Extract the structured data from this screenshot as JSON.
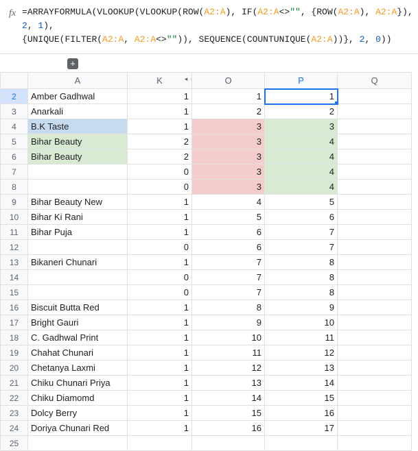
{
  "formula": {
    "parts": [
      {
        "t": "=",
        "c": "tok-func"
      },
      {
        "t": "ARRAYFORMULA",
        "c": "tok-func"
      },
      {
        "t": "(",
        "c": ""
      },
      {
        "t": "VLOOKUP",
        "c": "tok-func"
      },
      {
        "t": "(",
        "c": ""
      },
      {
        "t": "VLOOKUP",
        "c": "tok-func"
      },
      {
        "t": "(",
        "c": ""
      },
      {
        "t": "ROW",
        "c": "tok-func"
      },
      {
        "t": "(",
        "c": ""
      },
      {
        "t": "A2:A",
        "c": "tok-ref"
      },
      {
        "t": ")",
        "c": ""
      },
      {
        "t": ", ",
        "c": ""
      },
      {
        "t": "IF",
        "c": "tok-func"
      },
      {
        "t": "(",
        "c": ""
      },
      {
        "t": "A2:A",
        "c": "tok-ref"
      },
      {
        "t": "<>",
        "c": ""
      },
      {
        "t": "\"\"",
        "c": "tok-str"
      },
      {
        "t": ", {",
        "c": ""
      },
      {
        "t": "ROW",
        "c": "tok-func"
      },
      {
        "t": "(",
        "c": ""
      },
      {
        "t": "A2:A",
        "c": "tok-ref"
      },
      {
        "t": ")",
        "c": ""
      },
      {
        "t": ", ",
        "c": ""
      },
      {
        "t": "A2:A",
        "c": "tok-ref"
      },
      {
        "t": "})",
        "c": ""
      },
      {
        "t": ", ",
        "c": ""
      },
      {
        "t": "2",
        "c": "tok-num"
      },
      {
        "t": ", ",
        "c": ""
      },
      {
        "t": "1",
        "c": "tok-num"
      },
      {
        "t": "),",
        "c": ""
      },
      {
        "t": "\n",
        "c": ""
      },
      {
        "t": "{",
        "c": ""
      },
      {
        "t": "UNIQUE",
        "c": "tok-func"
      },
      {
        "t": "(",
        "c": ""
      },
      {
        "t": "FILTER",
        "c": "tok-func"
      },
      {
        "t": "(",
        "c": ""
      },
      {
        "t": "A2:A",
        "c": "tok-ref"
      },
      {
        "t": ", ",
        "c": ""
      },
      {
        "t": "A2:A",
        "c": "tok-ref"
      },
      {
        "t": "<>",
        "c": ""
      },
      {
        "t": "\"\"",
        "c": "tok-str"
      },
      {
        "t": "))",
        "c": ""
      },
      {
        "t": ", ",
        "c": ""
      },
      {
        "t": "SEQUENCE",
        "c": "tok-func"
      },
      {
        "t": "(",
        "c": ""
      },
      {
        "t": "COUNTUNIQUE",
        "c": "tok-func"
      },
      {
        "t": "(",
        "c": ""
      },
      {
        "t": "A2:A",
        "c": "tok-ref"
      },
      {
        "t": "))}",
        "c": ""
      },
      {
        "t": ", ",
        "c": ""
      },
      {
        "t": "2",
        "c": "tok-num"
      },
      {
        "t": ", ",
        "c": ""
      },
      {
        "t": "0",
        "c": "tok-num"
      },
      {
        "t": "))",
        "c": ""
      }
    ]
  },
  "fx_label": "fx",
  "add_col_glyph": "+",
  "columns": [
    {
      "id": "rowhdr",
      "label": "",
      "class": "col-rowhdr"
    },
    {
      "id": "A",
      "label": "A",
      "class": "col-A"
    },
    {
      "id": "K",
      "label": "K",
      "class": "col-K",
      "collapsed_right": true
    },
    {
      "id": "O",
      "label": "O",
      "class": "col-O"
    },
    {
      "id": "P",
      "label": "P",
      "class": "col-P",
      "selected": true
    },
    {
      "id": "Q",
      "label": "Q",
      "class": "col-Q"
    }
  ],
  "active_cell": {
    "row": 2,
    "col": "P"
  },
  "rows": [
    {
      "n": 2,
      "sel": true,
      "A": {
        "v": "Amber Gadhwal"
      },
      "K": {
        "v": "1"
      },
      "O": {
        "v": "1"
      },
      "P": {
        "v": "1",
        "active": true
      },
      "Q": {
        "v": ""
      }
    },
    {
      "n": 3,
      "A": {
        "v": "Anarkali"
      },
      "K": {
        "v": "1"
      },
      "O": {
        "v": "2"
      },
      "P": {
        "v": "2"
      },
      "Q": {
        "v": ""
      }
    },
    {
      "n": 4,
      "A": {
        "v": "B.K Taste",
        "hl": "blue"
      },
      "K": {
        "v": "1"
      },
      "O": {
        "v": "3",
        "hl": "red"
      },
      "P": {
        "v": "3",
        "hl": "green"
      },
      "Q": {
        "v": ""
      }
    },
    {
      "n": 5,
      "A": {
        "v": "Bihar Beauty",
        "hl": "green"
      },
      "K": {
        "v": "2"
      },
      "O": {
        "v": "3",
        "hl": "red"
      },
      "P": {
        "v": "4",
        "hl": "green"
      },
      "Q": {
        "v": ""
      }
    },
    {
      "n": 6,
      "A": {
        "v": "Bihar Beauty",
        "hl": "green"
      },
      "K": {
        "v": "2"
      },
      "O": {
        "v": "3",
        "hl": "red"
      },
      "P": {
        "v": "4",
        "hl": "green"
      },
      "Q": {
        "v": ""
      }
    },
    {
      "n": 7,
      "A": {
        "v": ""
      },
      "K": {
        "v": "0"
      },
      "O": {
        "v": "3",
        "hl": "red"
      },
      "P": {
        "v": "4",
        "hl": "green"
      },
      "Q": {
        "v": ""
      }
    },
    {
      "n": 8,
      "A": {
        "v": ""
      },
      "K": {
        "v": "0"
      },
      "O": {
        "v": "3",
        "hl": "red"
      },
      "P": {
        "v": "4",
        "hl": "green"
      },
      "Q": {
        "v": ""
      }
    },
    {
      "n": 9,
      "A": {
        "v": "Bihar Beauty New"
      },
      "K": {
        "v": "1"
      },
      "O": {
        "v": "4"
      },
      "P": {
        "v": "5"
      },
      "Q": {
        "v": ""
      }
    },
    {
      "n": 10,
      "A": {
        "v": "Bihar Ki Rani"
      },
      "K": {
        "v": "1"
      },
      "O": {
        "v": "5"
      },
      "P": {
        "v": "6"
      },
      "Q": {
        "v": ""
      }
    },
    {
      "n": 11,
      "A": {
        "v": "Bihar Puja"
      },
      "K": {
        "v": "1"
      },
      "O": {
        "v": "6"
      },
      "P": {
        "v": "7"
      },
      "Q": {
        "v": ""
      }
    },
    {
      "n": 12,
      "A": {
        "v": ""
      },
      "K": {
        "v": "0"
      },
      "O": {
        "v": "6"
      },
      "P": {
        "v": "7"
      },
      "Q": {
        "v": ""
      }
    },
    {
      "n": 13,
      "A": {
        "v": "Bikaneri Chunari"
      },
      "K": {
        "v": "1"
      },
      "O": {
        "v": "7"
      },
      "P": {
        "v": "8"
      },
      "Q": {
        "v": ""
      }
    },
    {
      "n": 14,
      "A": {
        "v": ""
      },
      "K": {
        "v": "0"
      },
      "O": {
        "v": "7"
      },
      "P": {
        "v": "8"
      },
      "Q": {
        "v": ""
      }
    },
    {
      "n": 15,
      "A": {
        "v": ""
      },
      "K": {
        "v": "0"
      },
      "O": {
        "v": "7"
      },
      "P": {
        "v": "8"
      },
      "Q": {
        "v": ""
      }
    },
    {
      "n": 16,
      "A": {
        "v": "Biscuit Butta Red"
      },
      "K": {
        "v": "1"
      },
      "O": {
        "v": "8"
      },
      "P": {
        "v": "9"
      },
      "Q": {
        "v": ""
      }
    },
    {
      "n": 17,
      "A": {
        "v": "Bright Gauri"
      },
      "K": {
        "v": "1"
      },
      "O": {
        "v": "9"
      },
      "P": {
        "v": "10"
      },
      "Q": {
        "v": ""
      }
    },
    {
      "n": 18,
      "A": {
        "v": "C. Gadhwal Print"
      },
      "K": {
        "v": "1"
      },
      "O": {
        "v": "10"
      },
      "P": {
        "v": "11"
      },
      "Q": {
        "v": ""
      }
    },
    {
      "n": 19,
      "A": {
        "v": "Chahat Chunari"
      },
      "K": {
        "v": "1"
      },
      "O": {
        "v": "11"
      },
      "P": {
        "v": "12"
      },
      "Q": {
        "v": ""
      }
    },
    {
      "n": 20,
      "A": {
        "v": "Chetanya Laxmi"
      },
      "K": {
        "v": "1"
      },
      "O": {
        "v": "12"
      },
      "P": {
        "v": "13"
      },
      "Q": {
        "v": ""
      }
    },
    {
      "n": 21,
      "A": {
        "v": "Chiku Chunari Priya"
      },
      "K": {
        "v": "1"
      },
      "O": {
        "v": "13"
      },
      "P": {
        "v": "14"
      },
      "Q": {
        "v": ""
      }
    },
    {
      "n": 22,
      "A": {
        "v": "Chiku Diamomd"
      },
      "K": {
        "v": "1"
      },
      "O": {
        "v": "14"
      },
      "P": {
        "v": "15"
      },
      "Q": {
        "v": ""
      }
    },
    {
      "n": 23,
      "A": {
        "v": "Dolcy Berry"
      },
      "K": {
        "v": "1"
      },
      "O": {
        "v": "15"
      },
      "P": {
        "v": "16"
      },
      "Q": {
        "v": ""
      }
    },
    {
      "n": 24,
      "A": {
        "v": "Doriya Chunari Red"
      },
      "K": {
        "v": "1"
      },
      "O": {
        "v": "16"
      },
      "P": {
        "v": "17"
      },
      "Q": {
        "v": ""
      }
    },
    {
      "n": 25,
      "A": {
        "v": ""
      },
      "K": {
        "v": ""
      },
      "O": {
        "v": ""
      },
      "P": {
        "v": ""
      },
      "Q": {
        "v": ""
      }
    }
  ]
}
